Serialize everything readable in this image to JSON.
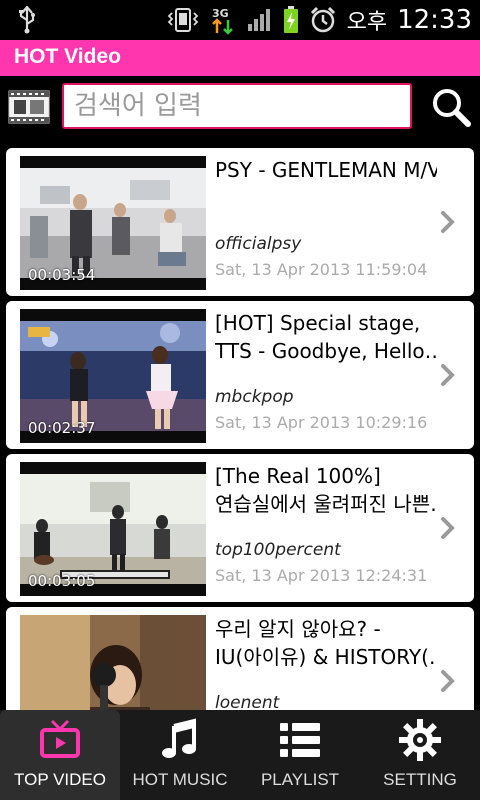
{
  "statusbar": {
    "ampm": "오후",
    "time": "12:33",
    "network": "3G"
  },
  "app": {
    "title": "HOT Video"
  },
  "search": {
    "placeholder": "검색어 입력",
    "value": ""
  },
  "videos": [
    {
      "title_lines": [
        "PSY - GENTLEMAN M/V"
      ],
      "channel": "officialpsy",
      "date": "Sat, 13 Apr 2013 11:59:04",
      "duration": "00:03:54"
    },
    {
      "title_lines": [
        "[HOT] Special stage,",
        "TTS - Goodbye, Hello…"
      ],
      "channel": "mbckpop",
      "date": "Sat, 13 Apr 2013 10:29:16",
      "duration": "00:02:37"
    },
    {
      "title_lines": [
        "[The Real 100%]",
        "연습실에서 울려퍼진 나쁜…"
      ],
      "channel": "top100percent",
      "date": "Sat, 13 Apr 2013 12:24:31",
      "duration": "00:03:05"
    },
    {
      "title_lines": [
        "우리 알지 않아요? -",
        "IU(아이유) & HISTORY(…"
      ],
      "channel": "loenent",
      "date": "",
      "duration": ""
    }
  ],
  "tabs": [
    {
      "label": "TOP VIDEO",
      "icon": "tv-icon",
      "active": true
    },
    {
      "label": "HOT MUSIC",
      "icon": "music-note-icon",
      "active": false
    },
    {
      "label": "PLAYLIST",
      "icon": "list-icon",
      "active": false
    },
    {
      "label": "SETTING",
      "icon": "gear-icon",
      "active": false
    }
  ],
  "colors": {
    "accent": "#ff36ad",
    "search_border": "#e0135f",
    "tab_active_icon": "#ff36ad"
  }
}
